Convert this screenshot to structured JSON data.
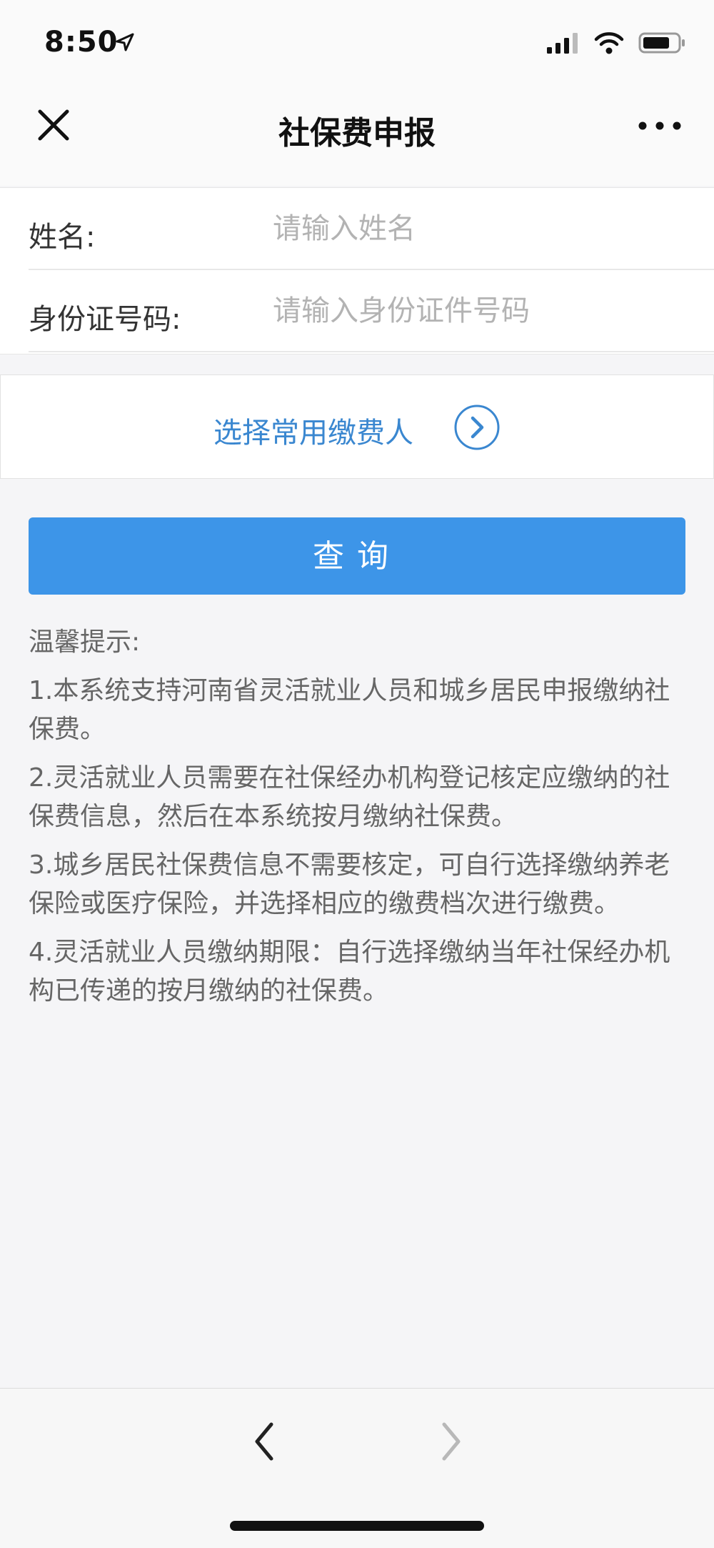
{
  "status_bar": {
    "time": "8:50",
    "icons": [
      "location-arrow-icon",
      "signal-icon",
      "wifi-icon",
      "battery-icon"
    ]
  },
  "nav": {
    "title": "社保费申报",
    "icons": [
      "close-icon",
      "more-icon"
    ]
  },
  "form": {
    "name_label": "姓名:",
    "name_placeholder": "请输入姓名",
    "id_label": "身份证号码:",
    "id_placeholder": "请输入身份证件号码"
  },
  "select_payer": {
    "label": "选择常用缴费人",
    "icon": "chevron-right-circle-icon"
  },
  "query_button": {
    "label": "查询"
  },
  "tips": {
    "title": "温馨提示:",
    "items": [
      "1.本系统支持河南省灵活就业人员和城乡居民申报缴纳社保费。",
      "2.灵活就业人员需要在社保经办机构登记核定应缴纳的社保费信息，然后在本系统按月缴纳社保费。",
      "3.城乡居民社保费信息不需要核定，可自行选择缴纳养老保险或医疗保险，并选择相应的缴费档次进行缴费。",
      "4.灵活就业人员缴纳期限：自行选择缴纳当年社保经办机构已传递的按月缴纳的社保费。"
    ]
  },
  "bottom_bar": {
    "icons": [
      "back-arrow-icon",
      "forward-arrow-icon"
    ]
  },
  "colors": {
    "accent": "#3d95e8",
    "link": "#3a87d0",
    "background": "#f5f5f7",
    "disabled_arrow": "#b8b8b8"
  }
}
